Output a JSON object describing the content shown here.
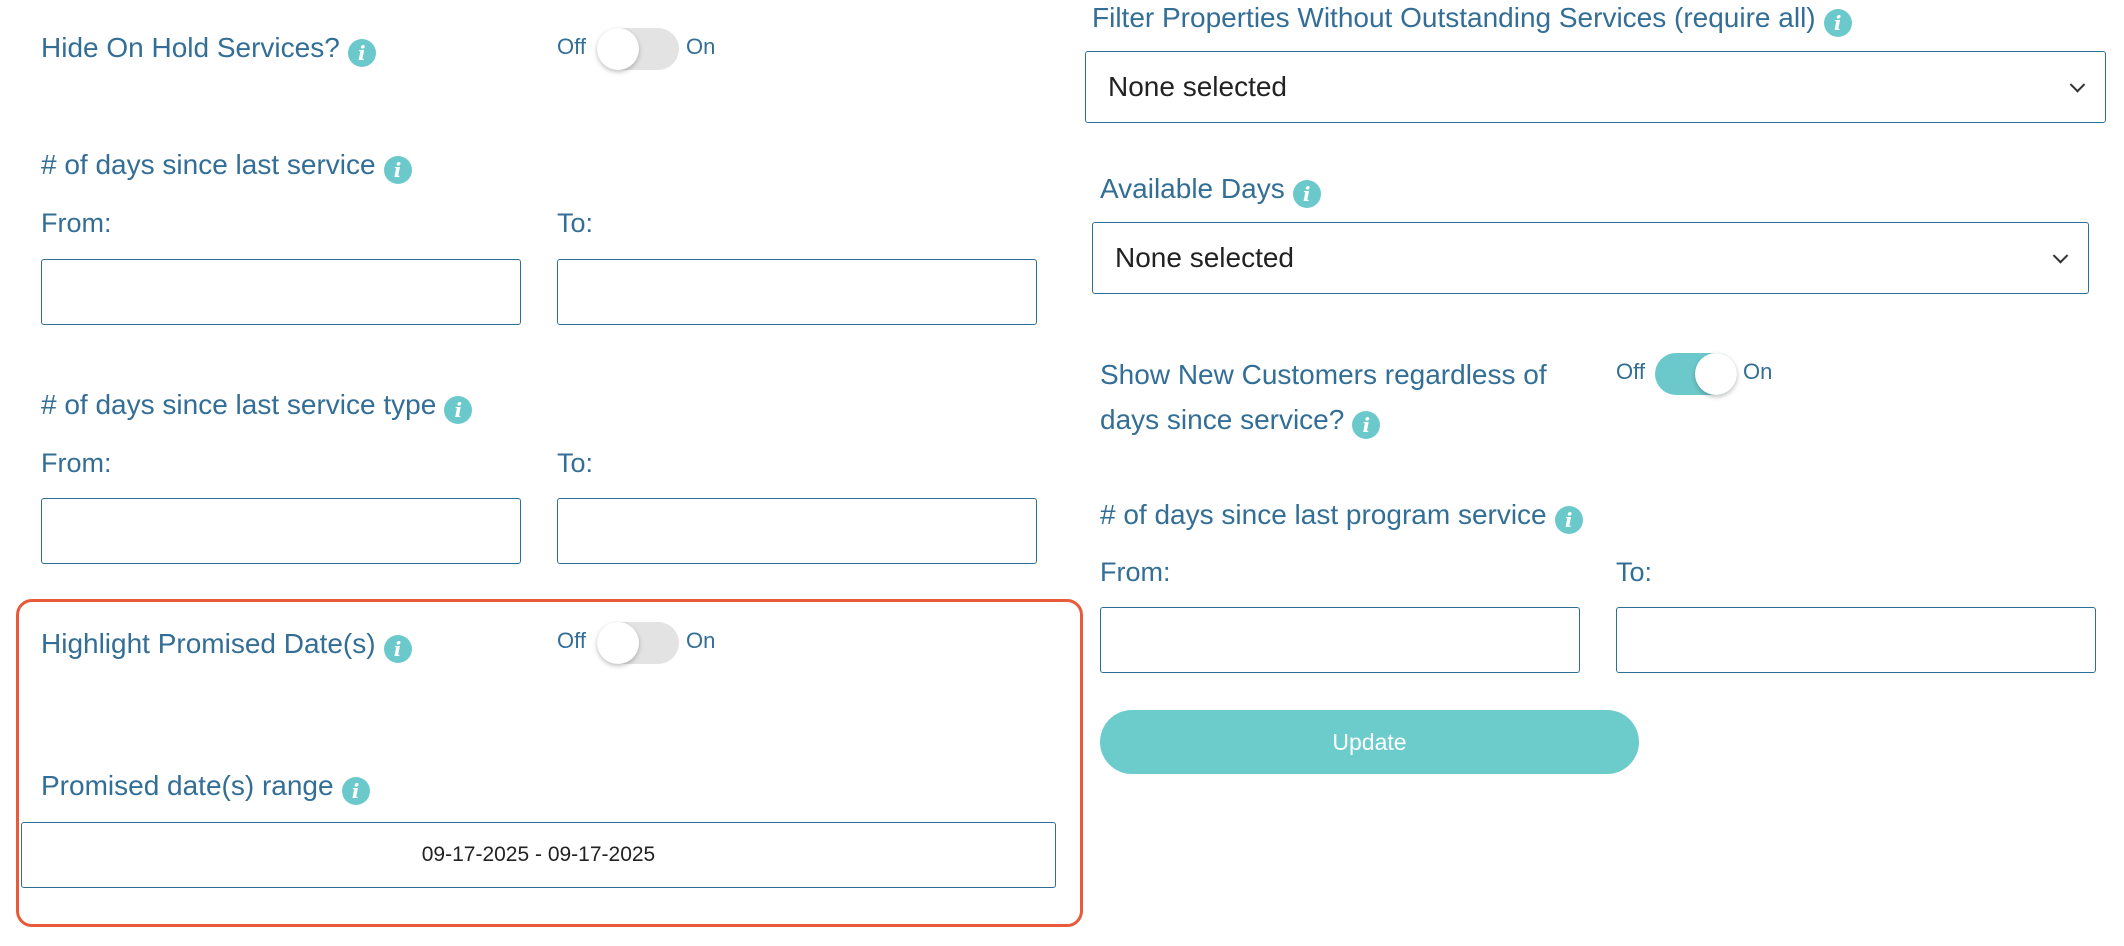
{
  "toggle_text": {
    "off": "Off",
    "on": "On"
  },
  "left": {
    "hide_on_hold": {
      "label": "Hide On Hold Services?",
      "state": "off"
    },
    "days_since_last_service": {
      "label": "# of days since last service",
      "from_label": "From:",
      "to_label": "To:",
      "from_value": "",
      "to_value": ""
    },
    "days_since_last_service_type": {
      "label": "# of days since last service type",
      "from_label": "From:",
      "to_label": "To:",
      "from_value": "",
      "to_value": ""
    },
    "highlight_promised": {
      "label": "Highlight Promised Date(s)",
      "state": "off"
    },
    "promised_range": {
      "label": "Promised date(s) range",
      "value": "09-17-2025 - 09-17-2025"
    }
  },
  "right": {
    "filter_properties": {
      "label": "Filter Properties Without Outstanding Services (require all)",
      "selected": "None selected"
    },
    "available_days": {
      "label": "Available Days",
      "selected": "None selected"
    },
    "show_new_customers": {
      "label_line1": "Show New Customers regardless of",
      "label_line2": "days since service?",
      "state": "on"
    },
    "days_since_program": {
      "label": "# of days since last program service",
      "from_label": "From:",
      "to_label": "To:",
      "from_value": "",
      "to_value": ""
    },
    "update_button": "Update"
  },
  "colors": {
    "label": "#336e96",
    "accent": "#6cc9cb",
    "highlight_border": "#e85a3a"
  },
  "icons": {
    "info": "info-icon",
    "dropdown": "chevron-down-icon"
  }
}
